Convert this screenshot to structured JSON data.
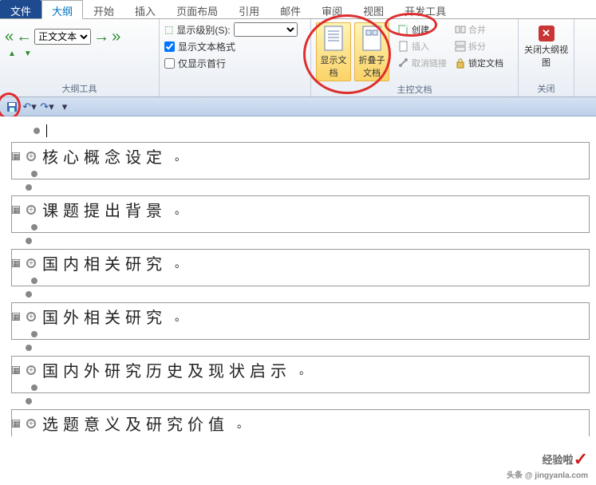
{
  "tabs": {
    "file": "文件",
    "outline": "大纲",
    "home": "开始",
    "insert": "插入",
    "page_layout": "页面布局",
    "reference": "引用",
    "mail": "邮件",
    "review": "审阅",
    "view": "视图",
    "developer": "开发工具"
  },
  "ribbon": {
    "body_text": "正文文本",
    "level_label": "显示级别(S):",
    "show_format": "显示文本格式",
    "first_line_only": "仅显示首行",
    "outline_tools": "大纲工具",
    "show_doc": "显示文档",
    "collapse_sub": "折叠子文档",
    "create": "创建",
    "merge": "合并",
    "insert_btn": "插入",
    "split": "拆分",
    "unlink": "取消链接",
    "lock": "锁定文档",
    "master_doc": "主控文档",
    "close_outline": "关闭大纲视图",
    "close": "关闭"
  },
  "outline": {
    "items": [
      {
        "title": "核心概念设定"
      },
      {
        "title": "课题提出背景"
      },
      {
        "title": "国内相关研究"
      },
      {
        "title": "国外相关研究"
      },
      {
        "title": "国内外研究历史及现状启示"
      },
      {
        "title": "选题意义及研究价值"
      }
    ]
  },
  "watermark": {
    "brand": "经验啦",
    "sub": "头条 @ jingyanla.com"
  }
}
